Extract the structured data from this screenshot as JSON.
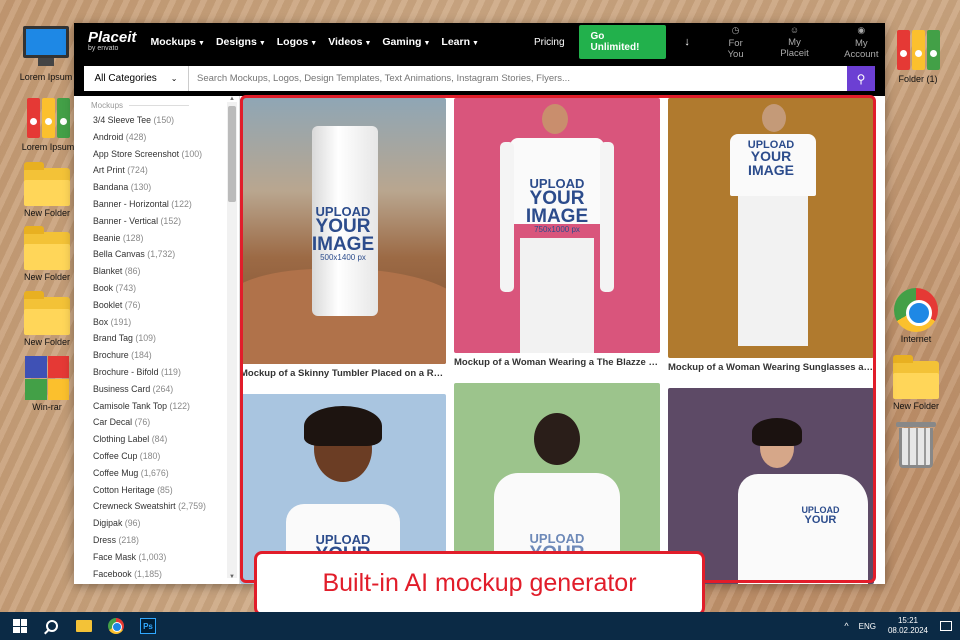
{
  "desktop": {
    "left_icons": [
      {
        "label": "Lorem Ipsum",
        "icon": "computer-icon"
      },
      {
        "label": "Lorem Ipsum",
        "icon": "binders-icon"
      },
      {
        "label": "New Folder",
        "icon": "folder-icon"
      },
      {
        "label": "New Folder",
        "icon": "folder-icon"
      },
      {
        "label": "New Folder",
        "icon": "folder-icon"
      },
      {
        "label": "Win-rar",
        "icon": "winrar-icon"
      }
    ],
    "right_icons": [
      {
        "label": "Folder (1)",
        "icon": "binders-icon"
      },
      {
        "label": "Internet",
        "icon": "chrome-icon"
      },
      {
        "label": "New Folder",
        "icon": "folder-icon"
      },
      {
        "label": "",
        "icon": "trash-icon"
      }
    ]
  },
  "site": {
    "logo": "Placeit",
    "logo_sub": "by envato",
    "nav": [
      "Mockups",
      "Designs",
      "Logos",
      "Videos",
      "Gaming",
      "Learn"
    ],
    "pricing": "Pricing",
    "cta": "Go Unlimited!",
    "user_nav": [
      {
        "label": "For You",
        "icon": "compass-icon"
      },
      {
        "label": "My Placeit",
        "icon": "smile-icon"
      },
      {
        "label": "My Account",
        "icon": "user-icon"
      }
    ],
    "category_select": "All Categories",
    "search_placeholder": "Search Mockups, Logos, Design Templates, Text Animations, Instagram Stories, Flyers..."
  },
  "sidebar": {
    "heading": "Mockups",
    "items": [
      {
        "name": "3/4 Sleeve Tee",
        "count": "(150)"
      },
      {
        "name": "Android",
        "count": "(428)"
      },
      {
        "name": "App Store Screenshot",
        "count": "(100)"
      },
      {
        "name": "Art Print",
        "count": "(724)"
      },
      {
        "name": "Bandana",
        "count": "(130)"
      },
      {
        "name": "Banner - Horizontal",
        "count": "(122)"
      },
      {
        "name": "Banner - Vertical",
        "count": "(152)"
      },
      {
        "name": "Beanie",
        "count": "(128)"
      },
      {
        "name": "Bella Canvas",
        "count": "(1,732)"
      },
      {
        "name": "Blanket",
        "count": "(86)"
      },
      {
        "name": "Book",
        "count": "(743)"
      },
      {
        "name": "Booklet",
        "count": "(76)"
      },
      {
        "name": "Box",
        "count": "(191)"
      },
      {
        "name": "Brand Tag",
        "count": "(109)"
      },
      {
        "name": "Brochure",
        "count": "(184)"
      },
      {
        "name": "Brochure - Bifold",
        "count": "(119)"
      },
      {
        "name": "Business Card",
        "count": "(264)"
      },
      {
        "name": "Camisole Tank Top",
        "count": "(122)"
      },
      {
        "name": "Car Decal",
        "count": "(76)"
      },
      {
        "name": "Clothing Label",
        "count": "(84)"
      },
      {
        "name": "Coffee Cup",
        "count": "(180)"
      },
      {
        "name": "Coffee Mug",
        "count": "(1,676)"
      },
      {
        "name": "Cotton Heritage",
        "count": "(85)"
      },
      {
        "name": "Crewneck Sweatshirt",
        "count": "(2,759)"
      },
      {
        "name": "Digipak",
        "count": "(96)"
      },
      {
        "name": "Dress",
        "count": "(218)"
      },
      {
        "name": "Face Mask",
        "count": "(1,003)"
      },
      {
        "name": "Facebook",
        "count": "(1,185)"
      }
    ]
  },
  "gallery": {
    "cards": [
      {
        "caption": "Mockup of a Skinny Tumbler Placed on a Ro...",
        "upload": [
          "UPLOAD",
          "YOUR",
          "IMAGE",
          "500x1400 px"
        ]
      },
      {
        "caption": "Mockup of a Woman Wearing a The Blazze C...",
        "upload": [
          "UPLOAD",
          "YOUR",
          "IMAGE",
          "750x1000 px"
        ]
      },
      {
        "caption": "Mockup of a Woman Wearing Sunglasses an...",
        "upload": [
          "UPLOAD",
          "YOUR",
          "IMAGE",
          ""
        ]
      },
      {
        "caption": "",
        "upload": [
          "UPLOAD",
          "YOUR",
          "",
          ""
        ]
      },
      {
        "caption": "",
        "upload": [
          "UPLOAD",
          "YOUR",
          "",
          ""
        ]
      },
      {
        "caption": "",
        "upload": [
          "UPLOAD",
          "YOUR",
          "",
          ""
        ]
      }
    ]
  },
  "callout": "Built-in AI mockup generator",
  "taskbar": {
    "lang": "ENG",
    "time": "15:21",
    "date": "08.02.2024",
    "apps": [
      "start-icon",
      "search-icon",
      "file-explorer-icon",
      "chrome-icon",
      "photoshop-icon"
    ],
    "ps_label": "Ps"
  },
  "colors": {
    "accent": "#22b14c",
    "search_button": "#6c3fd3",
    "highlight": "#e11d2a"
  }
}
